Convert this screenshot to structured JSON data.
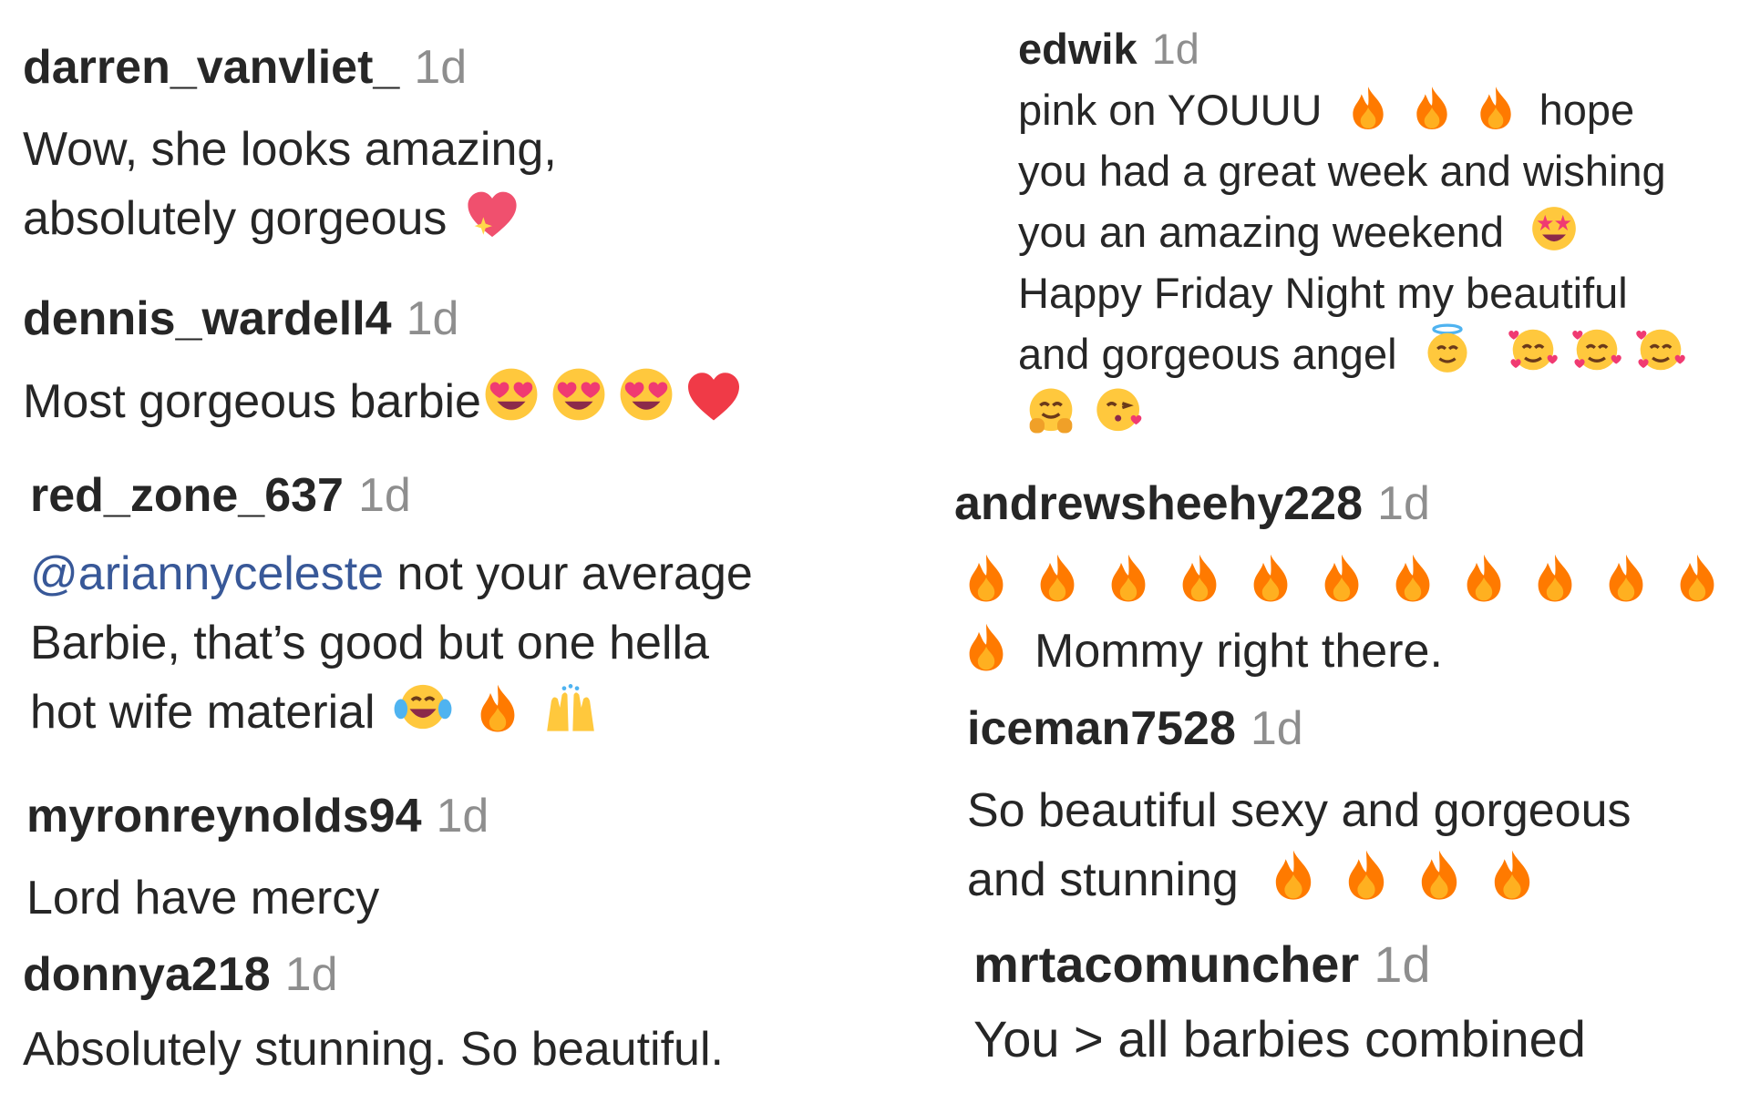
{
  "comments": [
    {
      "username": "darren_vanvliet_",
      "time": "1d",
      "lines": [
        "Wow, she looks amazing,",
        "absolutely gorgeous"
      ],
      "emojis": [
        "sparkling-heart"
      ]
    },
    {
      "username": "dennis_wardell4",
      "time": "1d",
      "text": "Most gorgeous barbie",
      "emojis": [
        "heart-eyes",
        "heart-eyes",
        "heart-eyes",
        "red-heart"
      ]
    },
    {
      "username": "red_zone_637",
      "time": "1d",
      "mention": "@ariannyceleste",
      "lines": [
        " not your average",
        "Barbie, that’s good but one hella",
        "hot wife material"
      ],
      "emojis": [
        "tears-of-joy",
        "fire",
        "raising-hands"
      ]
    },
    {
      "username": "myronreynolds94",
      "time": "1d",
      "text": "Lord have mercy"
    },
    {
      "username": "donnya218",
      "time": "1d",
      "text": "Absolutely stunning. So beautiful."
    },
    {
      "username": "edwik",
      "time": "1d",
      "lines": [
        "pink on YOUUU",
        " hope",
        "you had a great week and wishing",
        "you an amazing weekend",
        "Happy Friday Night my beautiful",
        "and gorgeous angel"
      ],
      "emojis": [
        "fire",
        "fire",
        "fire",
        "star-struck",
        "halo",
        "hearts-face",
        "hearts-face",
        "hearts-face",
        "hugging",
        "kissing-heart"
      ]
    },
    {
      "username": "andrewsheehy228",
      "time": "1d",
      "text": "Mommy right there.",
      "emojis": [
        "fire",
        "fire",
        "fire",
        "fire",
        "fire",
        "fire",
        "fire",
        "fire",
        "fire",
        "fire",
        "fire",
        "fire"
      ]
    },
    {
      "username": "iceman7528",
      "time": "1d",
      "lines": [
        "So beautiful sexy and gorgeous",
        "and stunning"
      ],
      "emojis": [
        "fire",
        "fire",
        "fire",
        "fire"
      ]
    },
    {
      "username": "mrtacomuncher",
      "time": "1d",
      "text": "You > all barbies combined"
    }
  ],
  "colors": {
    "username": "#262626",
    "time": "#8e8e8e",
    "mention": "#385898",
    "fire": "#ff7a00"
  }
}
